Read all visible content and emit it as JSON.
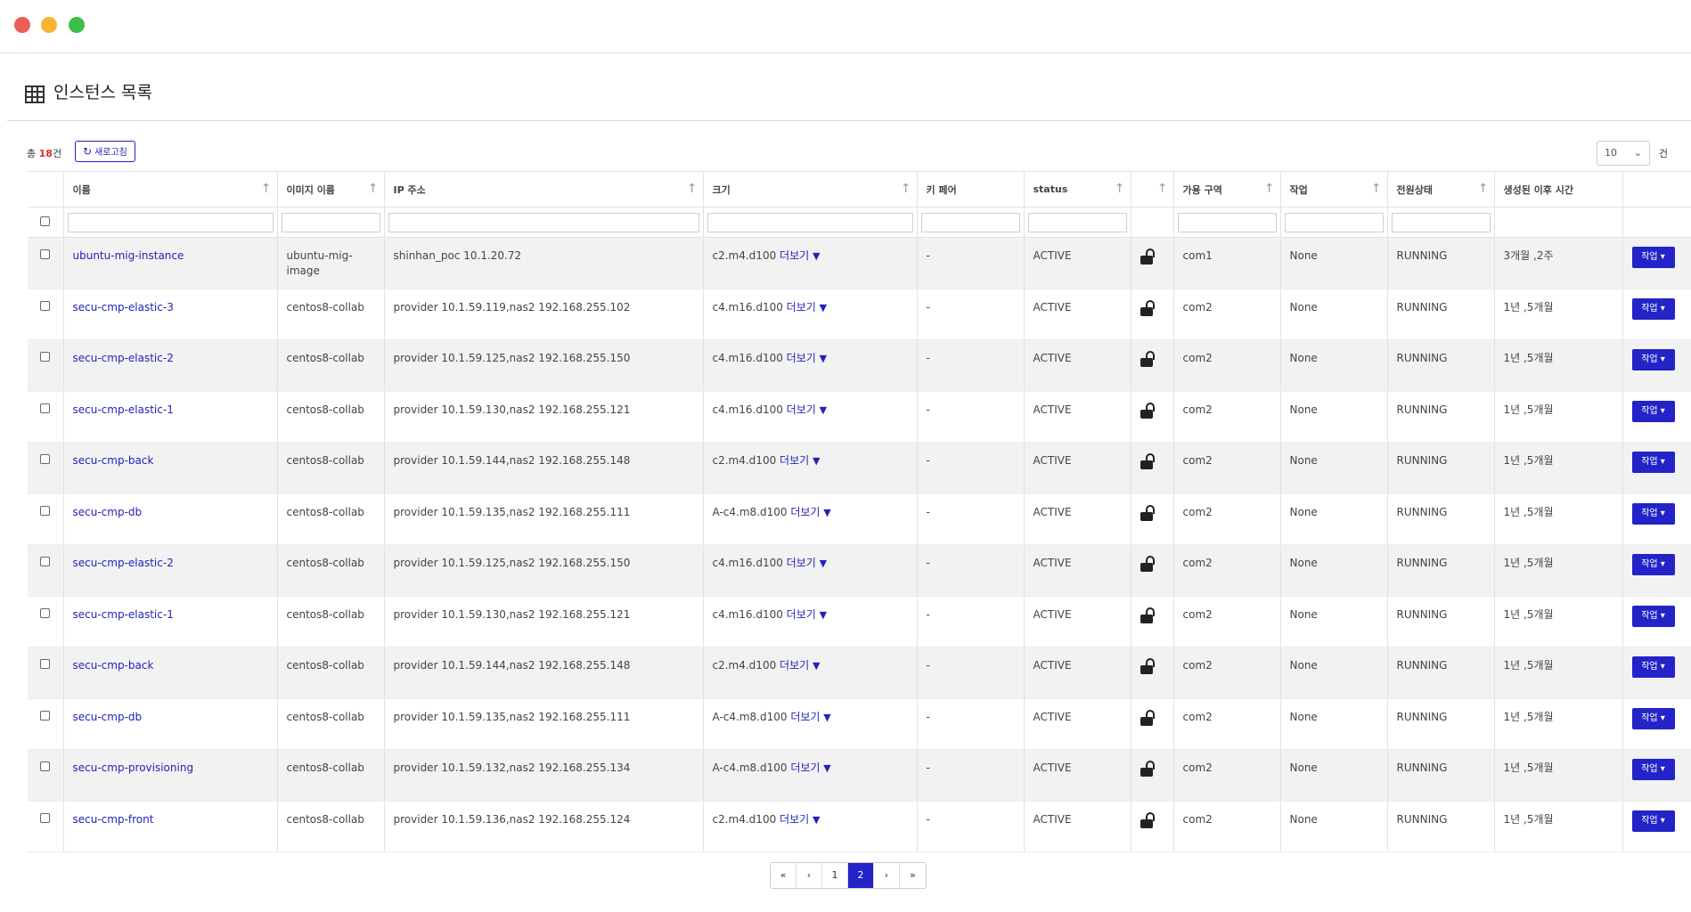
{
  "page": {
    "title": "인스턴스 목록"
  },
  "toolbar": {
    "total_prefix": "총",
    "total_count": "18",
    "total_suffix": "건",
    "refresh_label": "새로고침",
    "page_size": "10",
    "page_size_unit": "건"
  },
  "columns": [
    "이름",
    "이미지 이름",
    "IP 주소",
    "크기",
    "키 페어",
    "status",
    "",
    "가용 구역",
    "작업",
    "전원상태",
    "생성된 이후 시간"
  ],
  "more_label": "더보기",
  "rows": [
    {
      "name": "ubuntu-mig-instance",
      "image": "ubuntu-mig-image",
      "ip": "shinhan_poc 10.1.20.72",
      "size": "c2.m4.d100",
      "keypair": "-",
      "status": "ACTIVE",
      "zone": "com1",
      "task": "None",
      "power": "RUNNING",
      "age": "3개월 ,2주",
      "action": "작업"
    },
    {
      "name": "secu-cmp-elastic-3",
      "image": "centos8-collab",
      "ip": "provider 10.1.59.119,nas2 192.168.255.102",
      "size": "c4.m16.d100",
      "keypair": "-",
      "status": "ACTIVE",
      "zone": "com2",
      "task": "None",
      "power": "RUNNING",
      "age": "1년 ,5개월",
      "action": "작업"
    },
    {
      "name": "secu-cmp-elastic-2",
      "image": "centos8-collab",
      "ip": "provider 10.1.59.125,nas2 192.168.255.150",
      "size": "c4.m16.d100",
      "keypair": "-",
      "status": "ACTIVE",
      "zone": "com2",
      "task": "None",
      "power": "RUNNING",
      "age": "1년 ,5개월",
      "action": "작업"
    },
    {
      "name": "secu-cmp-elastic-1",
      "image": "centos8-collab",
      "ip": "provider 10.1.59.130,nas2 192.168.255.121",
      "size": "c4.m16.d100",
      "keypair": "-",
      "status": "ACTIVE",
      "zone": "com2",
      "task": "None",
      "power": "RUNNING",
      "age": "1년 ,5개월",
      "action": "작업"
    },
    {
      "name": "secu-cmp-back",
      "image": "centos8-collab",
      "ip": "provider 10.1.59.144,nas2 192.168.255.148",
      "size": "c2.m4.d100",
      "keypair": "-",
      "status": "ACTIVE",
      "zone": "com2",
      "task": "None",
      "power": "RUNNING",
      "age": "1년 ,5개월",
      "action": "작업"
    },
    {
      "name": "secu-cmp-db",
      "image": "centos8-collab",
      "ip": "provider 10.1.59.135,nas2 192.168.255.111",
      "size": "A-c4.m8.d100",
      "keypair": "-",
      "status": "ACTIVE",
      "zone": "com2",
      "task": "None",
      "power": "RUNNING",
      "age": "1년 ,5개월",
      "action": "작업"
    },
    {
      "name": "secu-cmp-elastic-2",
      "image": "centos8-collab",
      "ip": "provider 10.1.59.125,nas2 192.168.255.150",
      "size": "c4.m16.d100",
      "keypair": "-",
      "status": "ACTIVE",
      "zone": "com2",
      "task": "None",
      "power": "RUNNING",
      "age": "1년 ,5개월",
      "action": "작업"
    },
    {
      "name": "secu-cmp-elastic-1",
      "image": "centos8-collab",
      "ip": "provider 10.1.59.130,nas2 192.168.255.121",
      "size": "c4.m16.d100",
      "keypair": "-",
      "status": "ACTIVE",
      "zone": "com2",
      "task": "None",
      "power": "RUNNING",
      "age": "1년 ,5개월",
      "action": "작업"
    },
    {
      "name": "secu-cmp-back",
      "image": "centos8-collab",
      "ip": "provider 10.1.59.144,nas2 192.168.255.148",
      "size": "c2.m4.d100",
      "keypair": "-",
      "status": "ACTIVE",
      "zone": "com2",
      "task": "None",
      "power": "RUNNING",
      "age": "1년 ,5개월",
      "action": "작업"
    },
    {
      "name": "secu-cmp-db",
      "image": "centos8-collab",
      "ip": "provider 10.1.59.135,nas2 192.168.255.111",
      "size": "A-c4.m8.d100",
      "keypair": "-",
      "status": "ACTIVE",
      "zone": "com2",
      "task": "None",
      "power": "RUNNING",
      "age": "1년 ,5개월",
      "action": "작업"
    },
    {
      "name": "secu-cmp-provisioning",
      "image": "centos8-collab",
      "ip": "provider 10.1.59.132,nas2 192.168.255.134",
      "size": "A-c4.m8.d100",
      "keypair": "-",
      "status": "ACTIVE",
      "zone": "com2",
      "task": "None",
      "power": "RUNNING",
      "age": "1년 ,5개월",
      "action": "작업"
    },
    {
      "name": "secu-cmp-front",
      "image": "centos8-collab",
      "ip": "provider 10.1.59.136,nas2 192.168.255.124",
      "size": "c2.m4.d100",
      "keypair": "-",
      "status": "ACTIVE",
      "zone": "com2",
      "task": "None",
      "power": "RUNNING",
      "age": "1년 ,5개월",
      "action": "작업"
    }
  ],
  "pagination": {
    "first": "«",
    "prev": "‹",
    "pages": [
      "1",
      "2"
    ],
    "current": "2",
    "next": "›",
    "last": "»"
  },
  "colors": {
    "accent": "#2323c8",
    "link": "#2323b8",
    "count": "#d32f2f"
  },
  "icons": {
    "table": "grid-icon",
    "refresh": "refresh-icon",
    "lock": "unlock-icon",
    "dropdown": "chevron-down-icon"
  }
}
